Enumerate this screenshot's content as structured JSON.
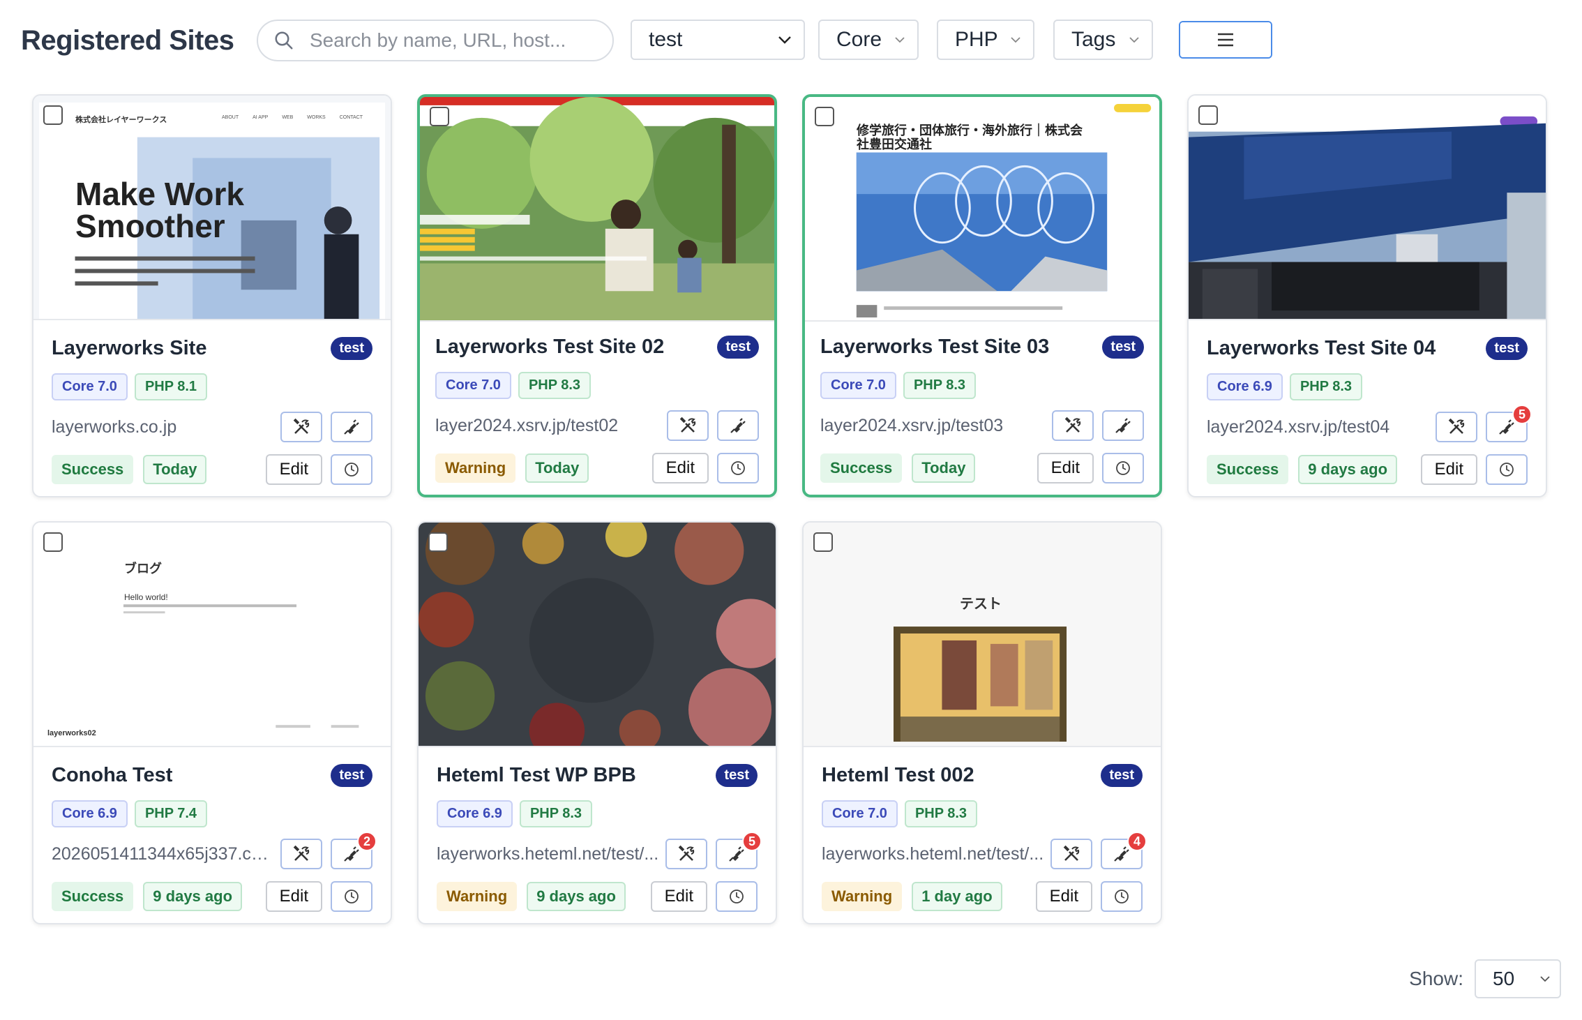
{
  "header": {
    "title": "Registered Sites",
    "search_placeholder": "Search by name, URL, host...",
    "filters": {
      "tag": "test",
      "core": "Core",
      "php": "PHP",
      "tags": "Tags"
    },
    "view": "grid"
  },
  "thumbs": {
    "t1": {
      "company": "株式会社レイヤーワークス",
      "nav": [
        "ABOUT",
        "AI APP",
        "WEB",
        "WORKS",
        "CONTACT"
      ],
      "headline1": "Make Work",
      "headline2": "Smoother"
    },
    "t3": {
      "heading1": "修学旅行・団体旅行・海外旅行｜株式会",
      "heading2": "社豊田交通社"
    },
    "t5": {
      "page_title": "ブログ",
      "post": "Hello world!",
      "footer": "layerworks02"
    },
    "t7": {
      "heading": "テスト"
    }
  },
  "sites": [
    {
      "name": "Layerworks Site",
      "tag": "test",
      "core": "Core 7.0",
      "php": "PHP 8.1",
      "url": "layerworks.co.jp",
      "status": "Success",
      "updated": "Today",
      "badge": ""
    },
    {
      "name": "Layerworks Test Site 02",
      "tag": "test",
      "core": "Core 7.0",
      "php": "PHP 8.3",
      "url": "layer2024.xsrv.jp/test02",
      "status": "Warning",
      "updated": "Today",
      "badge": ""
    },
    {
      "name": "Layerworks Test Site 03",
      "tag": "test",
      "core": "Core 7.0",
      "php": "PHP 8.3",
      "url": "layer2024.xsrv.jp/test03",
      "status": "Success",
      "updated": "Today",
      "badge": ""
    },
    {
      "name": "Layerworks Test Site 04",
      "tag": "test",
      "core": "Core 6.9",
      "php": "PHP 8.3",
      "url": "layer2024.xsrv.jp/test04",
      "status": "Success",
      "updated": "9 days ago",
      "badge": "5"
    },
    {
      "name": "Conoha Test",
      "tag": "test",
      "core": "Core 6.9",
      "php": "PHP 7.4",
      "url": "2026051411344x65j337.co...",
      "status": "Success",
      "updated": "9 days ago",
      "badge": "2"
    },
    {
      "name": "Heteml Test WP BPB",
      "tag": "test",
      "core": "Core 6.9",
      "php": "PHP 8.3",
      "url": "layerworks.heteml.net/test/...",
      "status": "Warning",
      "updated": "9 days ago",
      "badge": "5"
    },
    {
      "name": "Heteml Test 002",
      "tag": "test",
      "core": "Core 7.0",
      "php": "PHP 8.3",
      "url": "layerworks.heteml.net/test/...",
      "status": "Warning",
      "updated": "1 day ago",
      "badge": "4"
    }
  ],
  "labels": {
    "edit": "Edit"
  },
  "footer": {
    "show_label": "Show:",
    "per_page": "50"
  },
  "colors": {
    "accent": "#2f80ed",
    "selected_border": "#48b883",
    "tag_bg": "#1e2e8c",
    "badge": "#e53e3e"
  }
}
